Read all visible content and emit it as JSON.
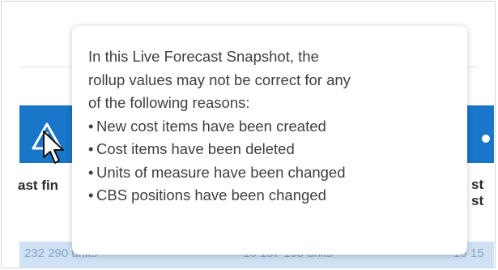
{
  "background": {
    "left_column_label": "ast fin",
    "right_column_label": "st st",
    "row_values": [
      "232 290 units",
      "16 157 160 units",
      "16 15"
    ],
    "header_color": "#1976c8",
    "row_color": "#cfe1f3"
  },
  "icons": {
    "warning": "warning-triangle-icon",
    "cursor": "mouse-pointer-icon"
  },
  "tooltip": {
    "lines": [
      "In this Live Forecast Snapshot, the",
      "rollup values may not be correct for any",
      "of the following reasons:"
    ],
    "bullet_glyph": "•",
    "reasons": [
      "New cost items have been created",
      "Cost items have been deleted",
      "Units of measure have been changed",
      "CBS positions have been changed"
    ]
  }
}
